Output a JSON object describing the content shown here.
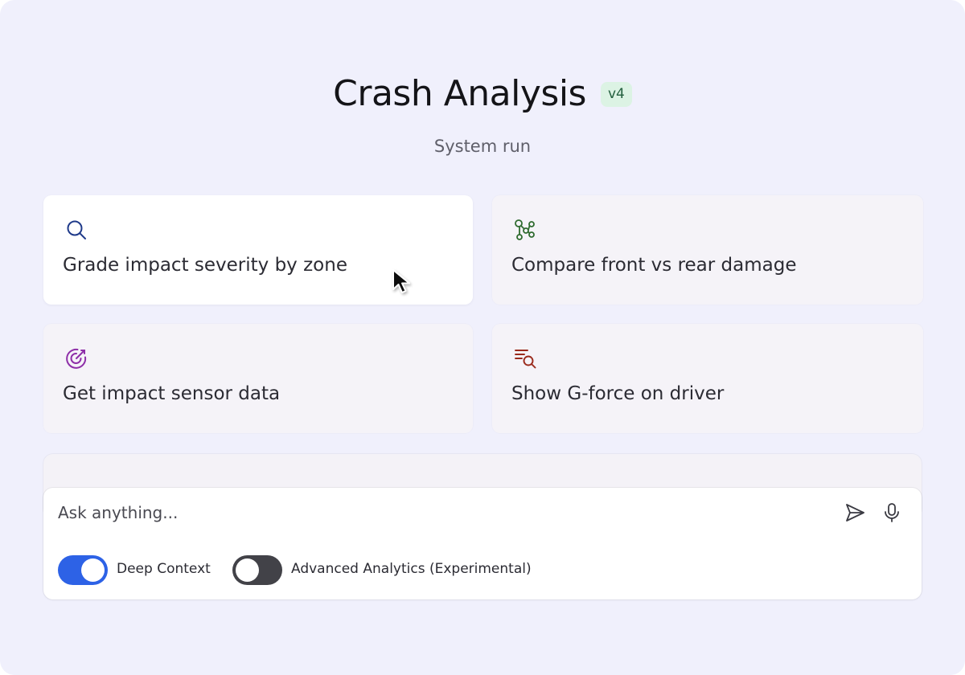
{
  "header": {
    "title": "Crash Analysis",
    "version_badge": "v4",
    "subtitle": "System run"
  },
  "suggestions": [
    {
      "label": "Grade impact severity by zone",
      "icon": "search-icon",
      "icon_color": "#1f3a8a"
    },
    {
      "label": "Compare front vs rear damage",
      "icon": "branch-nodes-icon",
      "icon_color": "#2f6b2f"
    },
    {
      "label": "Get impact sensor data",
      "icon": "target-icon",
      "icon_color": "#8e2fa8"
    },
    {
      "label": "Show G-force on driver",
      "icon": "list-search-icon",
      "icon_color": "#9a2a1c"
    }
  ],
  "composer": {
    "placeholder": "Ask anything...",
    "send_icon": "send-icon",
    "mic_icon": "microphone-icon"
  },
  "toggles": [
    {
      "label": "Deep Context",
      "state": "on",
      "color": "#2d62e6"
    },
    {
      "label": "Advanced Analytics (Experimental)",
      "state": "off",
      "color": "#424248"
    }
  ]
}
